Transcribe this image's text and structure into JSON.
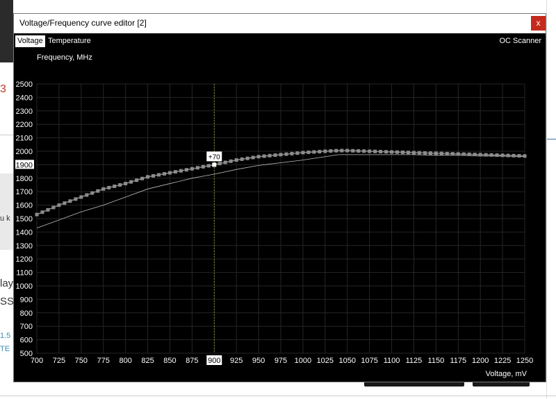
{
  "window": {
    "title": "Voltage/Frequency curve editor [2]",
    "close_label": "x"
  },
  "tabs": [
    {
      "label": "Voltage",
      "active": true
    },
    {
      "label": "Temperature",
      "active": false
    }
  ],
  "oc_scanner_label": "OC Scanner",
  "background_fragments": {
    "red_digit": "3",
    "text_1": "u k",
    "text_2": "lay",
    "text_3": "SS",
    "text_4": "1.5",
    "text_5": "TE"
  },
  "colors": {
    "chart_bg": "#000000",
    "grid": "#262626",
    "curve": "#8c8c8c",
    "baseline": "#bdbdbd",
    "cursor_line": "#8a8a2a",
    "label_text": "#ffffff",
    "close_button": "#c42b1c"
  },
  "chart_data": {
    "type": "line",
    "title": "",
    "ylabel": "Frequency, MHz",
    "xlabel": "Voltage, mV",
    "xlim": [
      700,
      1250
    ],
    "ylim": [
      500,
      2500
    ],
    "x_ticks": [
      "700",
      "725",
      "750",
      "775",
      "800",
      "825",
      "850",
      "875",
      "900",
      "925",
      "950",
      "975",
      "1000",
      "1025",
      "1050",
      "1075",
      "1100",
      "1125",
      "1150",
      "1175",
      "1200",
      "1225",
      "1250"
    ],
    "y_ticks": [
      "2500",
      "2400",
      "2300",
      "2200",
      "2100",
      "2000",
      "1900",
      "1800",
      "1700",
      "1600",
      "1500",
      "1400",
      "1300",
      "1200",
      "1100",
      "1000",
      "900",
      "800",
      "700",
      "600",
      "500"
    ],
    "grid": true,
    "selected_x": "900",
    "selected_y": "1900",
    "selected_point": {
      "x": 900,
      "y": 1900,
      "offset_label": "+70"
    },
    "series": [
      {
        "role": "curve",
        "x": [
          700,
          725,
          750,
          775,
          800,
          825,
          850,
          875,
          900,
          925,
          950,
          975,
          1000,
          1025,
          1040,
          1050,
          1075,
          1100,
          1125,
          1150,
          1175,
          1200,
          1225,
          1250
        ],
        "y": [
          1530,
          1600,
          1660,
          1720,
          1760,
          1810,
          1840,
          1870,
          1900,
          1935,
          1960,
          1975,
          1990,
          2000,
          2005,
          2005,
          2000,
          1995,
          1990,
          1985,
          1980,
          1975,
          1970,
          1965
        ]
      },
      {
        "role": "baseline",
        "x": [
          700,
          725,
          750,
          775,
          800,
          825,
          850,
          875,
          900,
          925,
          950,
          975,
          1000,
          1025,
          1040,
          1050,
          1075,
          1100,
          1125,
          1150,
          1175,
          1200,
          1225,
          1250
        ],
        "y": [
          1430,
          1490,
          1550,
          1600,
          1660,
          1720,
          1760,
          1800,
          1830,
          1865,
          1895,
          1915,
          1935,
          1960,
          1975,
          1975,
          1975,
          1975,
          1975,
          1970,
          1970,
          1965,
          1965,
          1960
        ]
      }
    ]
  }
}
